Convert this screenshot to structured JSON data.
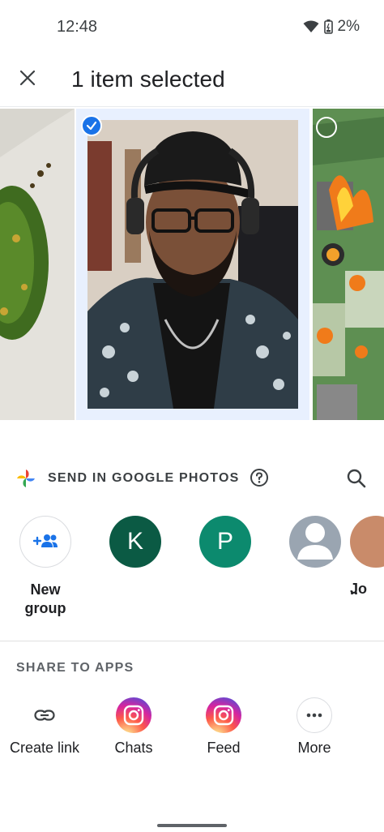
{
  "status_bar": {
    "time": "12:48",
    "battery": "2%"
  },
  "header": {
    "title": "1 item selected",
    "close_icon": "close-icon"
  },
  "photos": [
    {
      "selected": false,
      "subject": "food"
    },
    {
      "selected": true,
      "subject": "person"
    },
    {
      "selected": false,
      "subject": "map"
    }
  ],
  "send_section": {
    "label": "SEND IN GOOGLE PHOTOS",
    "help_icon": "help-icon",
    "search_icon": "search-icon"
  },
  "contacts": [
    {
      "initial": "",
      "name_line1": "New",
      "name_line2": "group",
      "color": "#ffffff",
      "icon": "add-group-icon"
    },
    {
      "initial": "K",
      "name_line1": "",
      "name_line2": "",
      "color": "#0b5a44"
    },
    {
      "initial": "P",
      "name_line1": "",
      "name_line2": "",
      "color": "#0c8a6e"
    },
    {
      "initial": "",
      "name_line1": "..",
      "name_line2": "",
      "color": "#9aa5b1",
      "icon": "person-icon"
    },
    {
      "initial": "",
      "name_line1": "Jo",
      "name_line2": "",
      "color": "#c98b6a"
    }
  ],
  "share_section": {
    "label": "SHARE TO APPS"
  },
  "apps": [
    {
      "label": "Create link",
      "icon": "link-icon"
    },
    {
      "label": "Chats",
      "icon": "instagram-icon"
    },
    {
      "label": "Feed",
      "icon": "instagram-icon"
    },
    {
      "label": "More",
      "icon": "more-icon"
    }
  ],
  "colors": {
    "accent": "#1a73e8",
    "text": "#202124",
    "secondary_text": "#5f6368"
  }
}
